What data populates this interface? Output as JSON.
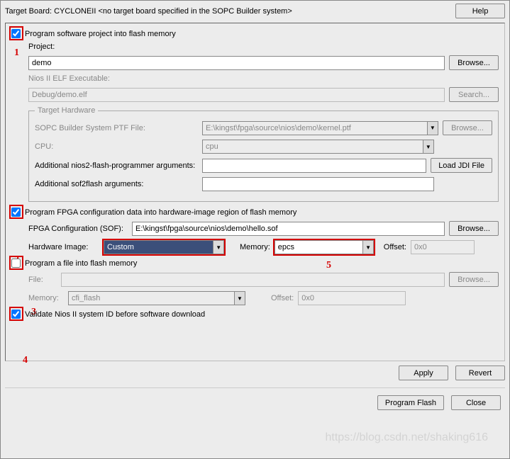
{
  "header": {
    "target_board_label": "Target Board:",
    "target_board_value": "CYCLONEII <no target board specified in the SOPC Builder system>",
    "help_btn": "Help"
  },
  "sec1": {
    "checkbox_label": "Program software project into flash memory",
    "project_label": "Project:",
    "project_value": "demo",
    "browse_btn": "Browse...",
    "elf_label": "Nios II ELF Executable:",
    "elf_value": "Debug/demo.elf",
    "search_btn": "Search...",
    "annotation": "1"
  },
  "target_hw": {
    "legend": "Target Hardware",
    "ptf_label": "SOPC Builder System PTF File:",
    "ptf_value": "E:\\kingst\\fpga\\source\\nios\\demo\\kernel.ptf",
    "browse_btn": "Browse...",
    "cpu_label": "CPU:",
    "cpu_value": "cpu",
    "arg1_label": "Additional nios2-flash-programmer arguments:",
    "arg2_label": "Additional sof2flash arguments:",
    "load_jdi_btn": "Load JDI File"
  },
  "sec2": {
    "checkbox_label": "Program FPGA configuration data into hardware-image region of flash memory",
    "sof_label": "FPGA Configuration (SOF):",
    "sof_value": "E:\\kingst\\fpga\\source\\nios\\demo\\hello.sof",
    "browse_btn": "Browse...",
    "hw_image_label": "Hardware Image:",
    "hw_image_value": "Custom",
    "memory_label": "Memory:",
    "memory_value": "epcs",
    "offset_label": "Offset:",
    "offset_value": "0x0",
    "annotation": "2",
    "annotation5": "5"
  },
  "sec3": {
    "checkbox_label": "Program a file into flash memory",
    "file_label": "File:",
    "browse_btn": "Browse...",
    "memory_label": "Memory:",
    "memory_value": "cfi_flash",
    "offset_label": "Offset:",
    "offset_value": "0x0",
    "annotation": "3"
  },
  "sec4": {
    "checkbox_label": "Validate Nios II system ID before software download",
    "annotation": "4"
  },
  "buttons": {
    "apply": "Apply",
    "revert": "Revert",
    "program_flash": "Program Flash",
    "close": "Close"
  },
  "watermark": "https://blog.csdn.net/shaking616"
}
